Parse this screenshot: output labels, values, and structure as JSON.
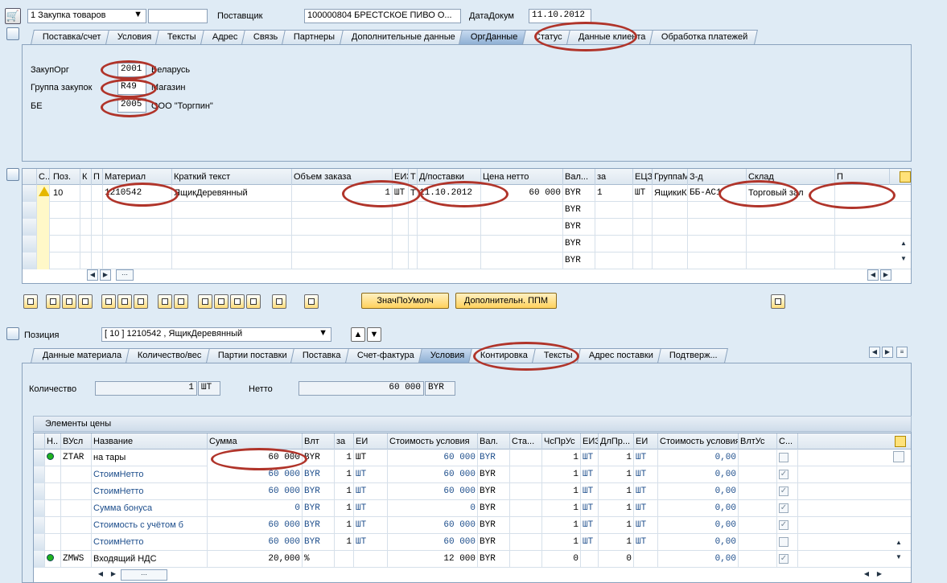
{
  "header": {
    "doc_type": "1 Закупка товаров",
    "doc_number": "",
    "vendor_label": "Поставщик",
    "vendor_value": "100000804 БРЕСТСКОЕ ПИВО О...",
    "docdate_label": "ДатаДокум",
    "docdate_value": "11.10.2012"
  },
  "header_tabs": [
    "Поставка/счет",
    "Условия",
    "Тексты",
    "Адрес",
    "Связь",
    "Партнеры",
    "Дополнительные данные",
    "ОргДанные",
    "Статус",
    "Данные клиента",
    "Обработка платежей"
  ],
  "org": {
    "purch_org_label": "ЗакупОрг",
    "purch_org": "2001",
    "purch_org_text": "Беларусь",
    "purch_group_label": "Группа закупок",
    "purch_group": "R49",
    "purch_group_text": "Магазин",
    "company_label": "БЕ",
    "company": "2005",
    "company_text": "ООО \"Торгпин\""
  },
  "items_grid": {
    "headers": [
      "С..",
      "Поз.",
      "К",
      "П",
      "Материал",
      "Краткий текст",
      "Объем заказа",
      "ЕИЗ",
      "Т",
      "Д/поставки",
      "Цена нетто",
      "Вал...",
      "за",
      "ЕЦЗ",
      "ГруппаМтр",
      "З-д",
      "Склад",
      "П"
    ],
    "row1": {
      "pos": "10",
      "material": "1210542",
      "short_text": "ЯщикДеревянный",
      "qty": "1",
      "uom": "ШТ",
      "t": "T",
      "delivery": "11.10.2012",
      "price": "60 000",
      "currency": "BYR",
      "per": "1",
      "ecz": "ШТ",
      "group": "ЯщикиКоро",
      "plant": "ББ-АС1",
      "storage": "Торговый зал"
    },
    "empty_currency": "BYR"
  },
  "toolbar": {
    "default_btn": "ЗначПоУмолч",
    "extra_btn": "Дополнительн. ППМ"
  },
  "item_selector": {
    "label": "Позиция",
    "value": "[ 10 ] 1210542 , ЯщикДеревянный"
  },
  "item_tabs": [
    "Данные материала",
    "Количество/вес",
    "Партии поставки",
    "Поставка",
    "Счет-фактура",
    "Условия",
    "Контировка",
    "Тексты",
    "Адрес поставки",
    "Подтверж..."
  ],
  "conditions": {
    "qty_label": "Количество",
    "qty": "1",
    "qty_uom": "ШТ",
    "net_label": "Нетто",
    "net": "60 000",
    "net_cur": "BYR",
    "section_title": "Элементы цены",
    "headers": [
      "Н..",
      "ВУсл",
      "Название",
      "Сумма",
      "Влт",
      "за",
      "ЕИ",
      "Стоимость условия",
      "Вал.",
      "Ста...",
      "ЧсПрУс",
      "ЕИЗ",
      "ДлПр...",
      "ЕИ",
      "Стоимость условия",
      "ВлтУс",
      "С..."
    ],
    "rows": [
      {
        "cond": "ZTAR",
        "name": "на тары",
        "amount": "60 000",
        "cur": "BYR",
        "per": "1",
        "uom": "ШТ",
        "value": "60 000",
        "vcur": "BYR",
        "num": "1",
        "uom2": "ШТ",
        "den": "1",
        "uom3": "ШТ",
        "value2": "0,00",
        "checked": ""
      },
      {
        "cond": "",
        "name": "СтоимНетто",
        "amount": "60 000",
        "cur": "BYR",
        "per": "1",
        "uom": "ШТ",
        "value": "60 000",
        "vcur": "BYR",
        "num": "1",
        "uom2": "ШТ",
        "den": "1",
        "uom3": "ШТ",
        "value2": "0,00",
        "checked": "✓"
      },
      {
        "cond": "",
        "name": "СтоимНетто",
        "amount": "60 000",
        "cur": "BYR",
        "per": "1",
        "uom": "ШТ",
        "value": "60 000",
        "vcur": "BYR",
        "num": "1",
        "uom2": "ШТ",
        "den": "1",
        "uom3": "ШТ",
        "value2": "0,00",
        "checked": "✓"
      },
      {
        "cond": "",
        "name": "Сумма бонуса",
        "amount": "0",
        "cur": "BYR",
        "per": "1",
        "uom": "ШТ",
        "value": "0",
        "vcur": "BYR",
        "num": "1",
        "uom2": "ШТ",
        "den": "1",
        "uom3": "ШТ",
        "value2": "0,00",
        "checked": "✓"
      },
      {
        "cond": "",
        "name": "Стоимость с учётом б",
        "amount": "60 000",
        "cur": "BYR",
        "per": "1",
        "uom": "ШТ",
        "value": "60 000",
        "vcur": "BYR",
        "num": "1",
        "uom2": "ШТ",
        "den": "1",
        "uom3": "ШТ",
        "value2": "0,00",
        "checked": "✓"
      },
      {
        "cond": "",
        "name": "СтоимНетто",
        "amount": "60 000",
        "cur": "BYR",
        "per": "1",
        "uom": "ШТ",
        "value": "60 000",
        "vcur": "BYR",
        "num": "1",
        "uom2": "ШТ",
        "den": "1",
        "uom3": "ШТ",
        "value2": "0,00",
        "checked": ""
      },
      {
        "cond": "ZMWS",
        "name": "Входящий НДС",
        "amount": "20,000",
        "cur": "%",
        "per": "",
        "uom": "",
        "value": "12 000",
        "vcur": "BYR",
        "num": "0",
        "uom2": "",
        "den": "0",
        "uom3": "",
        "value2": "0,00",
        "checked": "✓"
      }
    ]
  }
}
